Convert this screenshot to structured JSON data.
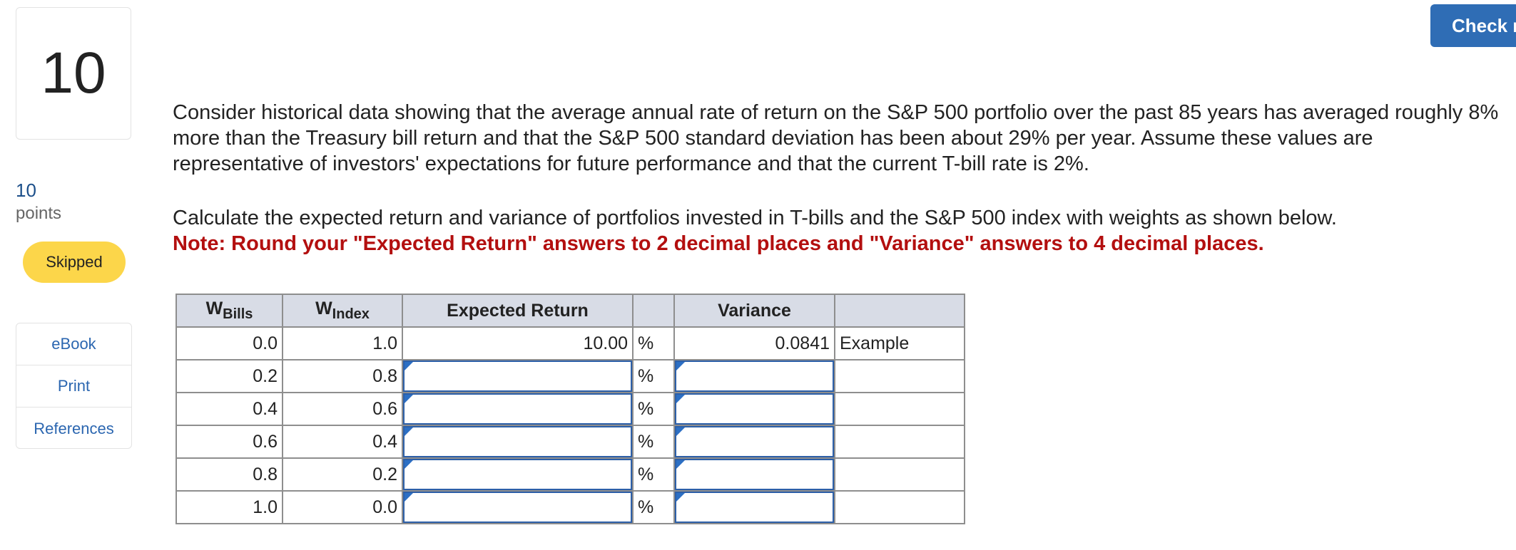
{
  "question": {
    "number": "10",
    "points_value": "10",
    "points_label": "points",
    "status": "Skipped"
  },
  "resources": [
    "eBook",
    "Print",
    "References"
  ],
  "check_button": "Check my work",
  "text": {
    "paragraph1": "Consider historical data showing that the average annual rate of return on the S&P 500 portfolio over the past 85 years has averaged roughly 8% more than the Treasury bill return and that the S&P 500 standard deviation has been about 29% per year. Assume these values are representative of investors' expectations for future performance and that the current T-bill rate is 2%.",
    "paragraph2": "Calculate the expected return and variance of portfolios invested in T-bills and the S&P 500 index with weights as shown below.",
    "note": "Note: Round your \"Expected Return\" answers to 2 decimal places and \"Variance\" answers to 4 decimal places."
  },
  "table": {
    "headers": {
      "bills_main": "W",
      "bills_sub": "Bills",
      "index_main": "W",
      "index_sub": "Index",
      "expected_return": "Expected Return",
      "variance": "Variance"
    },
    "example_row": {
      "bills": "0.0",
      "index": "1.0",
      "expected_return": "10.00",
      "percent": "%",
      "variance": "0.0841",
      "label": "Example"
    },
    "rows": [
      {
        "bills": "0.2",
        "index": "0.8",
        "percent": "%",
        "expected_return": "",
        "variance": ""
      },
      {
        "bills": "0.4",
        "index": "0.6",
        "percent": "%",
        "expected_return": "",
        "variance": ""
      },
      {
        "bills": "0.6",
        "index": "0.4",
        "percent": "%",
        "expected_return": "",
        "variance": ""
      },
      {
        "bills": "0.8",
        "index": "0.2",
        "percent": "%",
        "expected_return": "",
        "variance": ""
      },
      {
        "bills": "1.0",
        "index": "0.0",
        "percent": "%",
        "expected_return": "",
        "variance": ""
      }
    ]
  },
  "colors": {
    "check_button": "#2f6db5",
    "skipped_badge": "#fcd64a",
    "note_text": "#b30f0f",
    "header_bg": "#d8dce6",
    "input_border": "#2c5fa8"
  }
}
